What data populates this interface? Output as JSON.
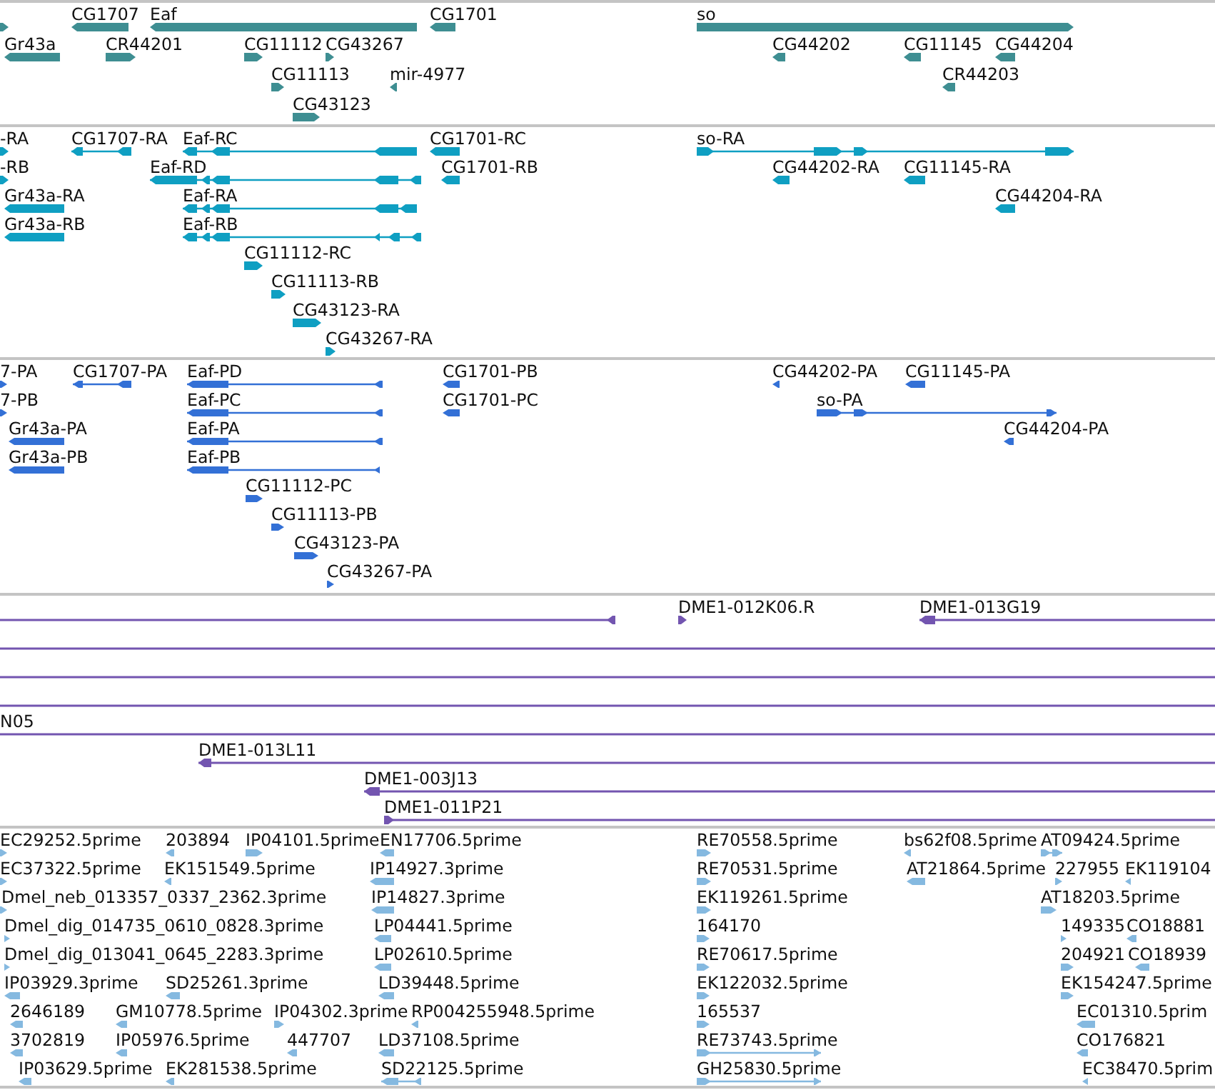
{
  "tracks": [
    {
      "kind": "gene",
      "color": "#3e8e92",
      "features": [
        {
          "reverse": false
        },
        {
          "label": "CG1707",
          "reverse": true
        },
        {
          "label": "Eaf",
          "reverse": true
        },
        {
          "label": "CG1701",
          "reverse": true
        },
        {
          "label": "so",
          "reverse": false
        },
        {
          "label": "Gr43a",
          "reverse": true
        },
        {
          "label": "CR44201",
          "reverse": false
        },
        {
          "label": "CG11112",
          "reverse": false
        },
        {
          "label": "CG43267",
          "reverse": false
        },
        {
          "label": "CG44202",
          "reverse": true
        },
        {
          "label": "CG11145",
          "reverse": true
        },
        {
          "label": "CG44204",
          "reverse": true
        },
        {
          "label": "CG11113",
          "reverse": false
        },
        {
          "label": "mir-4977",
          "reverse": true
        },
        {
          "label": "CR44203",
          "reverse": true
        },
        {
          "label": "CG43123",
          "reverse": false
        }
      ]
    },
    {
      "kind": "transcript",
      "color": "#0f9fc2",
      "features": [
        {
          "label": "-RA",
          "reverse": false
        },
        {
          "label": "CG1707-RA",
          "reverse": true
        },
        {
          "label": "Eaf-RC",
          "reverse": true
        },
        {
          "label": "CG1701-RC",
          "reverse": true
        },
        {
          "label": "so-RA",
          "reverse": false
        },
        {
          "label": "-RB",
          "reverse": false
        },
        {
          "label": "Eaf-RD",
          "reverse": true
        },
        {
          "label": "CG1701-RB",
          "reverse": true
        },
        {
          "label": "CG44202-RA",
          "reverse": true
        },
        {
          "label": "CG11145-RA",
          "reverse": true
        },
        {
          "label": "Gr43a-RA",
          "reverse": true
        },
        {
          "label": "Eaf-RA",
          "reverse": true
        },
        {
          "label": "CG44204-RA",
          "reverse": true
        },
        {
          "label": "Gr43a-RB",
          "reverse": true
        },
        {
          "label": "Eaf-RB",
          "reverse": true
        },
        {
          "label": "CG11112-RC",
          "reverse": false
        },
        {
          "label": "CG11113-RB",
          "reverse": false
        },
        {
          "label": "CG43123-RA",
          "reverse": false
        },
        {
          "label": "CG43267-RA",
          "reverse": false
        }
      ]
    },
    {
      "kind": "protein",
      "color": "#3370d6",
      "features": [
        {
          "label": "7-PA",
          "reverse": false
        },
        {
          "label": "CG1707-PA",
          "reverse": true
        },
        {
          "label": "Eaf-PD",
          "reverse": true
        },
        {
          "label": "CG1701-PB",
          "reverse": true
        },
        {
          "label": "CG44202-PA",
          "reverse": true
        },
        {
          "label": "CG11145-PA",
          "reverse": true
        },
        {
          "label": "7-PB",
          "reverse": false
        },
        {
          "label": "Eaf-PC",
          "reverse": true
        },
        {
          "label": "CG1701-PC",
          "reverse": true
        },
        {
          "label": "so-PA",
          "reverse": false
        },
        {
          "label": "Gr43a-PA",
          "reverse": true
        },
        {
          "label": "Eaf-PA",
          "reverse": true
        },
        {
          "label": "CG44204-PA",
          "reverse": true
        },
        {
          "label": "Gr43a-PB",
          "reverse": true
        },
        {
          "label": "Eaf-PB",
          "reverse": true
        },
        {
          "label": "CG11112-PC",
          "reverse": false
        },
        {
          "label": "CG11113-PB",
          "reverse": false
        },
        {
          "label": "CG43123-PA",
          "reverse": false
        },
        {
          "label": "CG43267-PA",
          "reverse": false
        }
      ]
    },
    {
      "kind": "clone",
      "color": "#7355b0",
      "features": [
        {
          "kind": "clone",
          "reverse": true
        },
        {
          "kind": "clone",
          "label": "DME1-012K06.R",
          "reverse": false
        },
        {
          "kind": "clone",
          "label": "DME1-013G19",
          "reverse": true
        },
        {
          "kind": "continued"
        },
        {
          "kind": "continued"
        },
        {
          "kind": "continued"
        },
        {
          "kind": "continued",
          "label": "N05"
        },
        {
          "kind": "clone",
          "label": "DME1-013L11",
          "reverse": true
        },
        {
          "kind": "clone",
          "label": "DME1-003J13",
          "reverse": true
        },
        {
          "kind": "clone",
          "label": "DME1-011P21",
          "reverse": false
        }
      ]
    },
    {
      "kind": "est",
      "color": "#85b9e0",
      "features": [
        {
          "label": "EC29252.5prime",
          "reverse": false
        },
        {
          "label": "203894",
          "reverse": true
        },
        {
          "label": "IP04101.5prime",
          "reverse": false
        },
        {
          "label": "EN17706.5prime",
          "reverse": true
        },
        {
          "label": "RE70558.5prime",
          "reverse": false
        },
        {
          "label": "bs62f08.5prime",
          "reverse": true
        },
        {
          "label": "AT09424.5prime",
          "reverse": false
        },
        {
          "label": "EC37322.5prime",
          "reverse": false
        },
        {
          "label": "EK151549.5prime",
          "reverse": true
        },
        {
          "label": "IP14927.3prime",
          "reverse": true
        },
        {
          "label": "RE70531.5prime",
          "reverse": false
        },
        {
          "label": "AT21864.5prime",
          "reverse": true
        },
        {
          "label": "227955",
          "reverse": false
        },
        {
          "label": "EK119104",
          "reverse": true
        },
        {
          "label": "Dmel_neb_013357_0337_2362.3prime",
          "reverse": false
        },
        {
          "label": "IP14827.3prime",
          "reverse": true
        },
        {
          "label": "EK119261.5prime",
          "reverse": false
        },
        {
          "label": "AT18203.5prime",
          "reverse": false
        },
        {
          "label": "Dmel_dig_014735_0610_0828.3prime",
          "reverse": false
        },
        {
          "label": "LP04441.5prime",
          "reverse": true
        },
        {
          "label": "164170",
          "reverse": false
        },
        {
          "label": "149335",
          "reverse": false
        },
        {
          "label": "CO18881",
          "reverse": true
        },
        {
          "label": "Dmel_dig_013041_0645_2283.3prime",
          "reverse": false
        },
        {
          "label": "LP02610.5prime",
          "reverse": true
        },
        {
          "label": "RE70617.5prime",
          "reverse": false
        },
        {
          "label": "204921",
          "reverse": false
        },
        {
          "label": "CO18939",
          "reverse": true
        },
        {
          "label": "IP03929.3prime",
          "reverse": true
        },
        {
          "label": "SD25261.3prime",
          "reverse": true
        },
        {
          "label": "LD39448.5prime",
          "reverse": true
        },
        {
          "label": "EK122032.5prime",
          "reverse": false
        },
        {
          "label": "EK154247.5prime",
          "reverse": false
        },
        {
          "label": "2646189",
          "reverse": true
        },
        {
          "label": "GM10778.5prime",
          "reverse": true
        },
        {
          "label": "IP04302.3prime",
          "reverse": false
        },
        {
          "label": "RP004255948.5prime",
          "reverse": true
        },
        {
          "label": "165537",
          "reverse": false
        },
        {
          "label": "EC01310.5prim",
          "reverse": true
        },
        {
          "label": "3702819",
          "reverse": true
        },
        {
          "label": "IP05976.5prime",
          "reverse": true
        },
        {
          "label": "447707",
          "reverse": true
        },
        {
          "label": "LD37108.5prime",
          "reverse": true
        },
        {
          "label": "RE73743.5prime",
          "reverse": false
        },
        {
          "label": "CO176821",
          "reverse": true
        },
        {
          "label": "IP03629.5prime",
          "reverse": true
        },
        {
          "label": "EK281538.5prime",
          "reverse": true
        },
        {
          "label": "SD22125.5prime",
          "reverse": true
        },
        {
          "label": "GH25830.5prime",
          "reverse": false
        },
        {
          "label": "EC38470.5prim",
          "reverse": true
        }
      ]
    }
  ]
}
